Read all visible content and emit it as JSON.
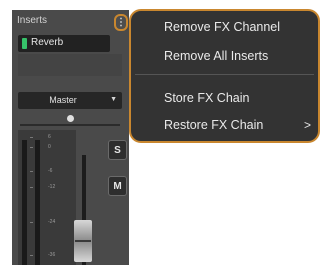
{
  "inserts": {
    "title": "Inserts",
    "more_glyph": "⋮",
    "slot": {
      "label": "Reverb",
      "active_color": "#36c36a"
    }
  },
  "routing": {
    "output_label": "Master",
    "caret": "▼"
  },
  "meter": {
    "scale": [
      "6",
      "0",
      "-6",
      "-12",
      "-24",
      "-36"
    ]
  },
  "buttons": {
    "solo": "S",
    "mute": "M"
  },
  "menu": {
    "items": [
      "Remove FX Channel",
      "Remove All Inserts",
      "Store FX Chain",
      "Restore FX Chain"
    ],
    "submenu_glyph": ">"
  },
  "colors": {
    "accent": "#c9872f",
    "panel": "#4a4a4a",
    "menu_bg": "#333333"
  }
}
